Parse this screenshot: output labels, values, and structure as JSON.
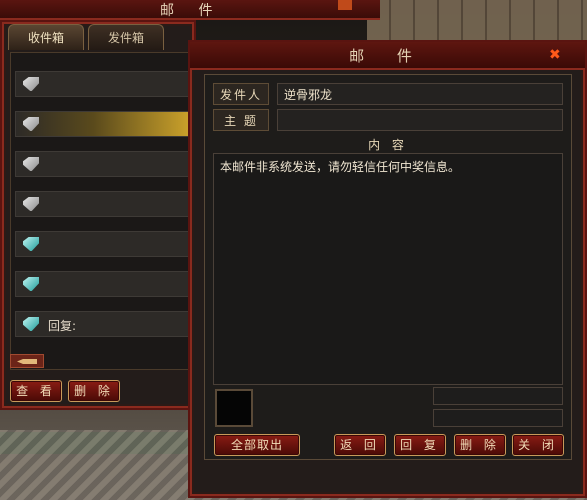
{
  "back_window": {
    "title": "邮 件"
  },
  "inbox": {
    "tabs": [
      {
        "label": "收件箱"
      },
      {
        "label": "发件箱"
      }
    ],
    "items": [
      {
        "icon": "gray-mail-icon",
        "label": "",
        "selected": false
      },
      {
        "icon": "gray-mail-icon",
        "label": "",
        "selected": true
      },
      {
        "icon": "gray-mail-icon",
        "label": "",
        "selected": false
      },
      {
        "icon": "gray-mail-icon",
        "label": "",
        "selected": false
      },
      {
        "icon": "teal-mail-icon",
        "label": "",
        "selected": false
      },
      {
        "icon": "teal-mail-icon",
        "label": "",
        "selected": false
      },
      {
        "icon": "teal-mail-icon",
        "label": "回复:",
        "selected": false
      }
    ],
    "buttons": {
      "view": "查 看",
      "delete": "删 除"
    }
  },
  "mail": {
    "title": "邮 件",
    "sender_label": "发件人",
    "sender_value": "逆骨邪龙",
    "subject_label": "主 题",
    "subject_value": "",
    "content_label": "内 容",
    "content_text": "本邮件非系统发送，请勿轻信任何中奖信息。",
    "buttons": {
      "take_all": "全部取出",
      "back": "返 回",
      "reply": "回 复",
      "delete": "删 除",
      "close": "关 闭"
    }
  },
  "colors": {
    "frame": "#8a2a1e",
    "button": "#8a1c14",
    "selected_row": "#c9a02a"
  }
}
